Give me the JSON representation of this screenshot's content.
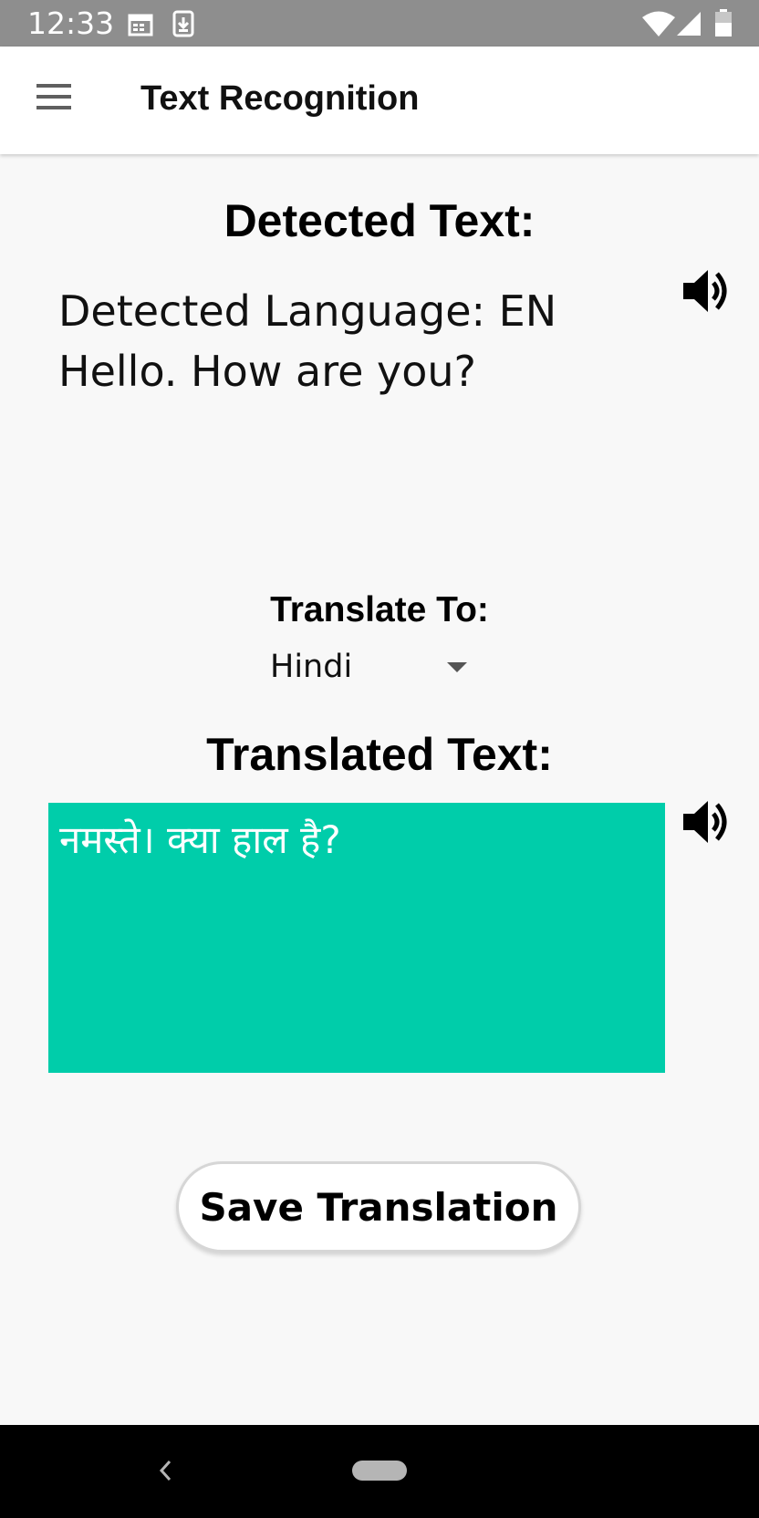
{
  "status_bar": {
    "time": "12:33",
    "icons": [
      "calendar-icon",
      "download-icon",
      "wifi-icon",
      "signal-icon",
      "battery-icon"
    ]
  },
  "app_bar": {
    "title": "Text Recognition",
    "menu_icon": "hamburger-menu-icon"
  },
  "detected": {
    "heading": "Detected Text:",
    "language_line": "Detected Language: EN",
    "text": "Hello. How are you?",
    "speaker_icon": "speaker-icon"
  },
  "translate": {
    "label": "Translate To:",
    "selected_language": "Hindi"
  },
  "translated": {
    "heading": "Translated Text:",
    "text": "नमस्ते। क्या हाल है?",
    "speaker_icon": "speaker-icon",
    "box_color": "#00cdaa"
  },
  "actions": {
    "save_label": "Save Translation"
  },
  "nav_bar": {
    "icons": [
      "back-icon",
      "home-pill-icon"
    ]
  }
}
